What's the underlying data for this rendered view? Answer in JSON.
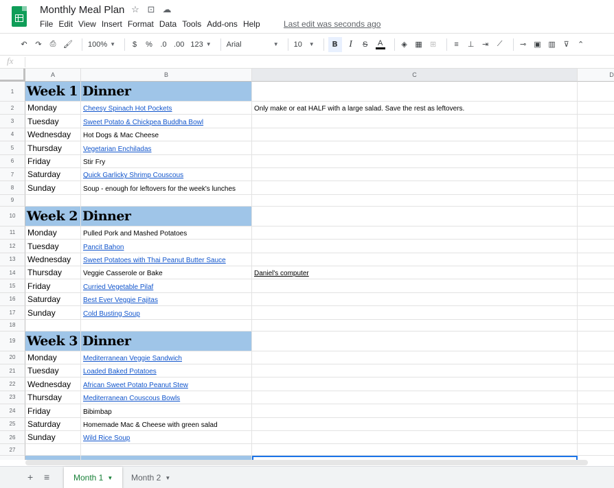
{
  "app": {
    "doc_title": "Monthly Meal Plan",
    "last_edit": "Last edit was seconds ago",
    "title_icons": [
      "star-icon",
      "move-to-folder-icon",
      "cloud-status-icon"
    ]
  },
  "menu": [
    "File",
    "Edit",
    "View",
    "Insert",
    "Format",
    "Data",
    "Tools",
    "Add-ons",
    "Help"
  ],
  "toolbar": {
    "zoom": "100%",
    "currency": "$",
    "percent": "%",
    "dec_decrease": ".0",
    "dec_increase": ".00",
    "more_formats": "123",
    "font": "Arial",
    "font_size": "10",
    "bold": "B",
    "italic": "I",
    "strike": "S",
    "text_color": "A"
  },
  "formula_bar": {
    "fx": "fx",
    "value": ""
  },
  "columns": [
    "A",
    "B",
    "C",
    "D"
  ],
  "rows": [
    {
      "n": "1",
      "type": "header",
      "a": "Week 1",
      "b": "Dinner",
      "c": ""
    },
    {
      "n": "2",
      "type": "day",
      "a": "Monday",
      "b": "Cheesy Spinach Hot Pockets",
      "b_link": true,
      "c": "Only make or eat HALF with a large salad. Save the rest as leftovers."
    },
    {
      "n": "3",
      "type": "day",
      "a": "Tuesday",
      "b": "Sweet Potato & Chickpea Buddha Bowl",
      "b_link": true,
      "c": ""
    },
    {
      "n": "4",
      "type": "day",
      "a": "Wednesday",
      "b": "Hot Dogs & Mac Cheese",
      "b_link": false,
      "c": ""
    },
    {
      "n": "5",
      "type": "day",
      "a": "Thursday",
      "b": "Vegetarian Enchiladas",
      "b_link": true,
      "c": ""
    },
    {
      "n": "6",
      "type": "day",
      "a": "Friday",
      "b": "Stir Fry",
      "b_link": false,
      "c": ""
    },
    {
      "n": "7",
      "type": "day",
      "a": "Saturday",
      "b": "Quick Garlicky Shrimp Couscous",
      "b_link": true,
      "c": ""
    },
    {
      "n": "8",
      "type": "day",
      "a": "Sunday",
      "b": "Soup - enough for leftovers for the week's lunches",
      "b_link": false,
      "c": ""
    },
    {
      "n": "9",
      "type": "blank",
      "a": "",
      "b": "",
      "c": ""
    },
    {
      "n": "10",
      "type": "header",
      "a": "Week 2",
      "b": "Dinner",
      "c": ""
    },
    {
      "n": "11",
      "type": "day",
      "a": "Monday",
      "b": "Pulled Pork and Mashed Potatoes",
      "b_link": false,
      "c": ""
    },
    {
      "n": "12",
      "type": "day",
      "a": "Tuesday",
      "b": "Pancit Bahon",
      "b_link": true,
      "c": ""
    },
    {
      "n": "13",
      "type": "day",
      "a": "Wednesday",
      "b": "Sweet Potatoes with Thai Peanut Butter Sauce",
      "b_link": true,
      "c": ""
    },
    {
      "n": "14",
      "type": "day",
      "a": "Thursday",
      "b": "Veggie Casserole or Bake",
      "b_link": false,
      "c": "Daniel's computer",
      "c_underline": true
    },
    {
      "n": "15",
      "type": "day",
      "a": "Friday",
      "b": "Curried Vegetable Pilaf",
      "b_link": true,
      "c": ""
    },
    {
      "n": "16",
      "type": "day",
      "a": "Saturday",
      "b": "Best Ever Veggie Fajitas",
      "b_link": true,
      "c": ""
    },
    {
      "n": "17",
      "type": "day",
      "a": "Sunday",
      "b": "Cold Busting Soup",
      "b_link": true,
      "c": ""
    },
    {
      "n": "18",
      "type": "blank",
      "a": "",
      "b": "",
      "c": ""
    },
    {
      "n": "19",
      "type": "header",
      "a": "Week 3",
      "b": "Dinner",
      "c": ""
    },
    {
      "n": "20",
      "type": "day",
      "a": "Monday",
      "b": "Mediterranean Veggie Sandwich",
      "b_link": true,
      "c": ""
    },
    {
      "n": "21",
      "type": "day",
      "a": "Tuesday",
      "b": "Loaded Baked Potatoes",
      "b_link": true,
      "c": ""
    },
    {
      "n": "22",
      "type": "day",
      "a": "Wednesday",
      "b": "African Sweet Potato Peanut Stew",
      "b_link": true,
      "c": ""
    },
    {
      "n": "23",
      "type": "day",
      "a": "Thursday",
      "b": "Mediterranean Couscous Bowls",
      "b_link": true,
      "c": ""
    },
    {
      "n": "24",
      "type": "day",
      "a": "Friday",
      "b": "Bibimbap",
      "b_link": false,
      "c": ""
    },
    {
      "n": "25",
      "type": "day",
      "a": "Saturday",
      "b": "Homemade Mac & Cheese with green salad",
      "b_link": false,
      "c": ""
    },
    {
      "n": "26",
      "type": "day",
      "a": "Sunday",
      "b": "Wild Rice Soup",
      "b_link": true,
      "c": ""
    },
    {
      "n": "27",
      "type": "blank",
      "a": "",
      "b": "",
      "c": ""
    },
    {
      "n": "",
      "type": "header-partial",
      "a": "",
      "b": "",
      "c": ""
    }
  ],
  "sheets": [
    {
      "label": "Month 1",
      "active": true
    },
    {
      "label": "Month 2",
      "active": false
    }
  ],
  "colors": {
    "header_fill": "#9fc5e8",
    "link": "#1155cc",
    "active_tab": "#188038",
    "selection": "#1a73e8"
  }
}
